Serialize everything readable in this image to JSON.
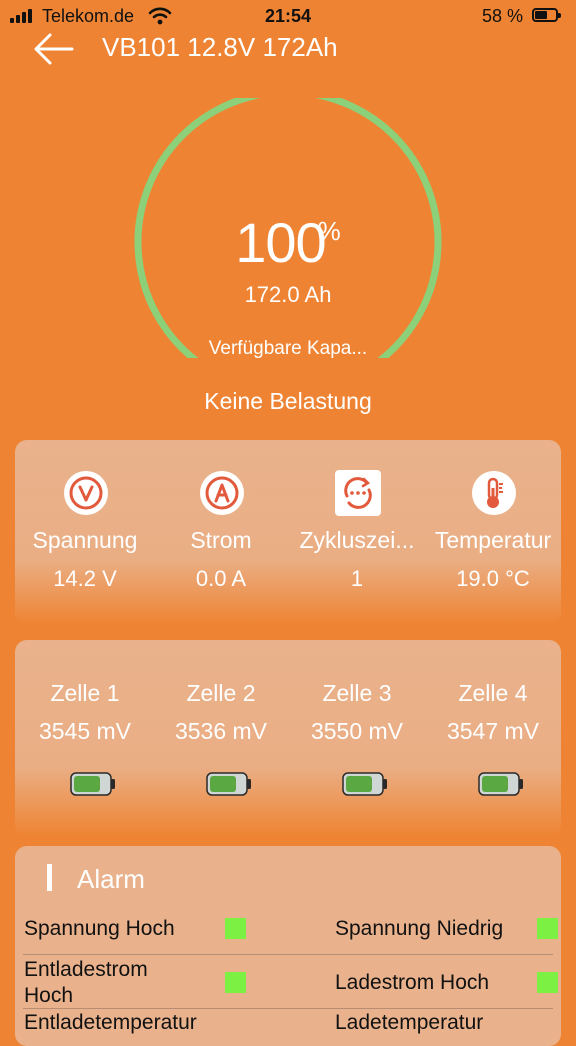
{
  "status_bar": {
    "carrier": "Telekom.de",
    "time": "21:54",
    "battery_percent": "58 %",
    "battery_level": 0.58
  },
  "header": {
    "title": "VB101 12.8V 172Ah"
  },
  "gauge": {
    "percent_value": "100",
    "percent_unit": "%",
    "level": 1.0,
    "capacity": "172.0 Ah",
    "caption": "Verfügbare Kapa...",
    "arc_color": "#8cd07a"
  },
  "load_status": "Keine Belastung",
  "metrics": [
    {
      "icon": "voltage-icon",
      "label": "Spannung",
      "value": "14.2 V"
    },
    {
      "icon": "current-icon",
      "label": "Strom",
      "value": "0.0 A"
    },
    {
      "icon": "cycle-icon",
      "label": "Zykluszei...",
      "value": "1"
    },
    {
      "icon": "thermometer-icon",
      "label": "Temperatur",
      "value": "19.0 °C"
    }
  ],
  "cells": [
    {
      "label": "Zelle 1",
      "value": "3545 mV",
      "icon": "cell-battery-icon"
    },
    {
      "label": "Zelle 2",
      "value": "3536 mV",
      "icon": "cell-battery-icon"
    },
    {
      "label": "Zelle 3",
      "value": "3550 mV",
      "icon": "cell-battery-icon"
    },
    {
      "label": "Zelle 4",
      "value": "3547 mV",
      "icon": "cell-battery-icon"
    }
  ],
  "alarm": {
    "title": "Alarm",
    "items": [
      {
        "left": "Spannung Hoch",
        "right": "Spannung Niedrig"
      },
      {
        "left": "Entladestrom Hoch",
        "right": "Ladestrom Hoch"
      },
      {
        "left": "Entladetemperatur",
        "right": "Ladetemperatur"
      }
    ],
    "indicator_color": "#7df044"
  },
  "colors": {
    "background": "#ee8433",
    "card": "#e9b28c",
    "icon_accent": "#e2593c"
  }
}
